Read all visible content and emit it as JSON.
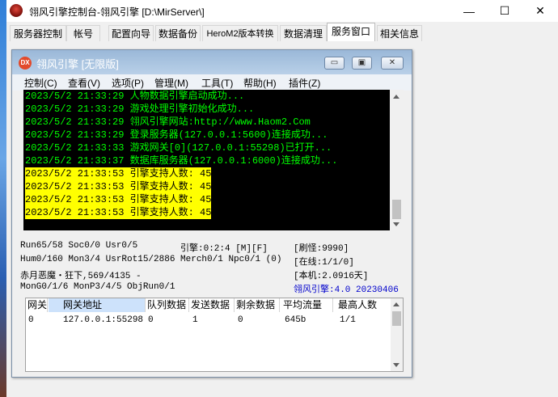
{
  "window": {
    "title": "翎风引擎控制台-翎风引擎 [D:\\MirServer\\]",
    "minimize": "—",
    "maximize": "☐",
    "close": "✕"
  },
  "tabs": [
    {
      "label": "服务器控制"
    },
    {
      "label": "帐号"
    },
    {
      "label": "配置向导"
    },
    {
      "label": "数据备份"
    },
    {
      "label": "HeroM2版本转换"
    },
    {
      "label": "数据清理"
    },
    {
      "label": "服务窗口"
    },
    {
      "label": "相关信息"
    }
  ],
  "selected_tab": "服务窗口",
  "engine": {
    "icon_text": "DX",
    "title": "翎风引擎 [无限版]",
    "menu": [
      "控制(C)",
      "查看(V)",
      "选项(P)",
      "管理(M)",
      "工具(T)",
      "帮助(H)",
      "插件(Z)"
    ],
    "log": [
      {
        "text": "2023/5/2 21:33:29 人物数据引擎启动成功...",
        "highlight": false
      },
      {
        "text": "2023/5/2 21:33:29 游戏处理引擎初始化成功...",
        "highlight": false
      },
      {
        "text": "2023/5/2 21:33:29 翎风引擎网站:http://www.Haom2.Com",
        "highlight": false
      },
      {
        "text": "2023/5/2 21:33:29 登录服务器(127.0.0.1:5600)连接成功...",
        "highlight": false
      },
      {
        "text": "2023/5/2 21:33:33 游戏网关[0](127.0.0.1:55298)已打开...",
        "highlight": false
      },
      {
        "text": "2023/5/2 21:33:37 数据库服务器(127.0.0.1:6000)连接成功...",
        "highlight": false
      },
      {
        "text": "2023/5/2 21:33:53 引擎支持人数: 45",
        "highlight": true
      },
      {
        "text": "2023/5/2 21:33:53 引擎支持人数: 45",
        "highlight": true
      },
      {
        "text": "2023/5/2 21:33:53 引擎支持人数: 45",
        "highlight": true
      },
      {
        "text": "2023/5/2 21:33:53 引擎支持人数: 45",
        "highlight": true
      }
    ],
    "status": {
      "line1_left": "Run65/58 Soc0/0 Usr0/5",
      "line1_mid": "引擎:0:2:4 [M][F]",
      "line1_right": "[刷怪:9990]",
      "line2_left": "Hum0/160 Mon3/4 UsrRot15/2886 Merch0/1 Npc0/1 (0)",
      "line2_right": "[在线:1/1/0]",
      "line3_left": "赤月恶魔・狂下,569/4135 -",
      "line3_right": "[本机:2.0916天]",
      "line4_left": "MonG0/1/6 MonP3/4/5 ObjRun0/1",
      "line4_right": "翎风引擎:4.0 20230406"
    },
    "table": {
      "columns": [
        "网关",
        "网关地址",
        "队列数据",
        "发送数据",
        "剩余数据",
        "平均流量",
        "最高人数"
      ],
      "selected_column": "网关地址",
      "rows": [
        [
          "0",
          "127.0.0.1:55298",
          "0",
          "1",
          "0",
          "645b",
          "1/1"
        ]
      ]
    }
  },
  "colors": {
    "console_bg": "#000000",
    "console_text": "#00ff00",
    "highlight_bg": "#ffff00",
    "version_text": "#0000cc",
    "inner_title": "#9ab8d8"
  }
}
